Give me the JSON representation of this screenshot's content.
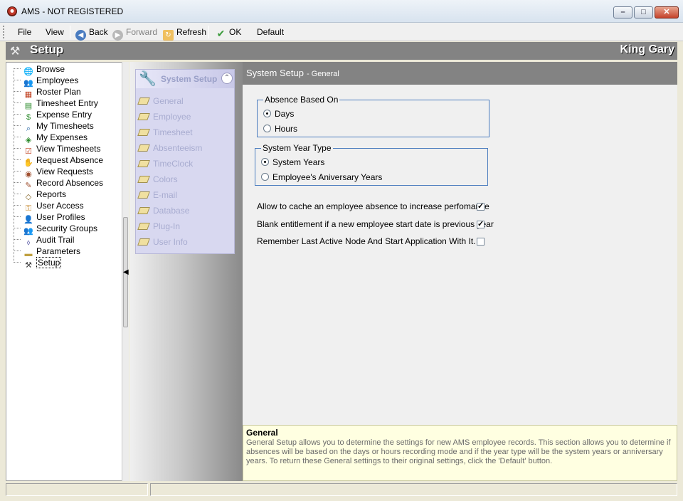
{
  "window": {
    "title": "AMS - NOT REGISTERED"
  },
  "toolbar": {
    "file": "File",
    "view": "View",
    "back": "Back",
    "forward": "Forward",
    "refresh": "Refresh",
    "ok": "OK",
    "default": "Default"
  },
  "header": {
    "title": "Setup",
    "user": "King Gary"
  },
  "tree": {
    "items": [
      {
        "label": "Browse",
        "icon": "globe-icon"
      },
      {
        "label": "Employees",
        "icon": "people-icon"
      },
      {
        "label": "Roster Plan",
        "icon": "calendar-icon"
      },
      {
        "label": "Timesheet Entry",
        "icon": "timesheet-icon"
      },
      {
        "label": "Expense Entry",
        "icon": "dollar-icon"
      },
      {
        "label": "My Timesheets",
        "icon": "search-timesheet-icon"
      },
      {
        "label": "My Expenses",
        "icon": "expense-icon"
      },
      {
        "label": "View Timesheets",
        "icon": "checklist-icon"
      },
      {
        "label": "Request Absence",
        "icon": "hand-icon"
      },
      {
        "label": "View Requests",
        "icon": "eye-icon"
      },
      {
        "label": "Record Absences",
        "icon": "pencil-icon"
      },
      {
        "label": "Reports",
        "icon": "report-icon"
      },
      {
        "label": "User Access",
        "icon": "key-user-icon"
      },
      {
        "label": "User Profiles",
        "icon": "profiles-icon"
      },
      {
        "label": "Security Groups",
        "icon": "group-icon"
      },
      {
        "label": "Audit Trail",
        "icon": "audit-icon"
      },
      {
        "label": "Parameters",
        "icon": "folder-icon"
      },
      {
        "label": "Setup",
        "icon": "tools-icon",
        "selected": true
      }
    ]
  },
  "system_setup": {
    "title": "System Setup",
    "items": [
      "General",
      "Employee",
      "Timesheet",
      "Absenteeism",
      "TimeClock",
      "Colors",
      "E-mail",
      "Database",
      "Plug-In",
      "User Info"
    ]
  },
  "content": {
    "title": "System Setup",
    "subtitle": "- General",
    "absence_group": {
      "legend": "Absence Based On",
      "options": [
        {
          "label": "Days",
          "selected": true
        },
        {
          "label": "Hours",
          "selected": false
        }
      ]
    },
    "year_group": {
      "legend": "System Year Type",
      "options": [
        {
          "label": "System Years",
          "selected": true
        },
        {
          "label": "Employee's Aniversary Years",
          "selected": false
        }
      ]
    },
    "checks": [
      {
        "label": "Allow to cache an employee absence to increase perfomance",
        "checked": true
      },
      {
        "label": "Blank entitlement if a new employee start date is previous year",
        "checked": true
      },
      {
        "label": "Remember Last Active Node And Start Application With It.",
        "checked": false
      }
    ]
  },
  "help": {
    "title": "General",
    "text": "General Setup allows you to determine the settings for new AMS employee records.  This section allows you to determine if absences will be based on the days or hours recording mode and if the year type will be the system years or anniversary years. To return these General settings to their original settings, click the 'Default' button."
  },
  "colors": {
    "header_gray": "#838383",
    "group_border": "#4c7dbf",
    "help_bg": "#ffffe1"
  }
}
